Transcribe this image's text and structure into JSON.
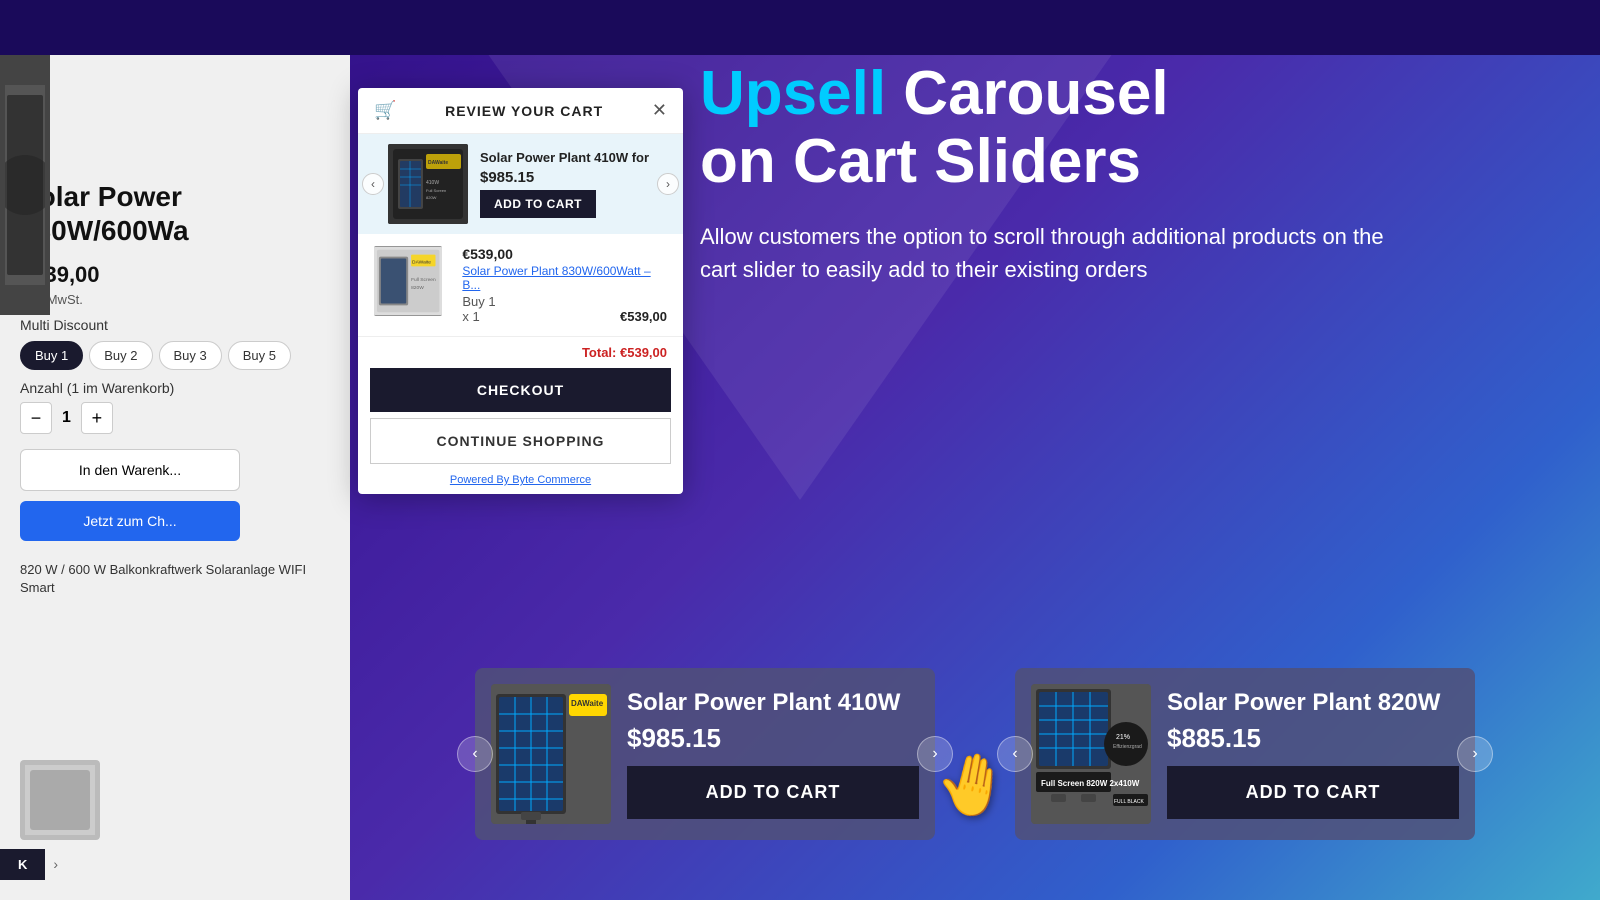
{
  "page": {
    "title": "Upsell Carousel on Cart Sliders"
  },
  "headline": {
    "upsell": "Upsell",
    "rest": " Carousel\non Cart Sliders"
  },
  "subtext": "Allow customers the option to scroll through additional products on the cart slider to easily add to their existing orders",
  "cart_modal": {
    "title": "REVIEW YOUR CART",
    "upsell_product": {
      "name": "Solar Power Plant 410W for",
      "price": "$985.15",
      "add_btn": "ADD TO CART"
    },
    "cart_item": {
      "price": "€539,00",
      "name": "Solar Power Plant 830W/600Watt – B...",
      "buy": "Buy 1",
      "qty": "x 1",
      "subtotal": "€539,00"
    },
    "total_label": "Total:",
    "total_value": "€539,00",
    "checkout_btn": "CHECKOUT",
    "continue_btn": "CONTINUE SHOPPING",
    "powered_by": "Powered By Byte Commerce"
  },
  "left_product": {
    "title": "Solar Power\n830W/600Wa",
    "price": "€539,00",
    "inkl": "inkl. MwSt.",
    "multi_discount_label": "Multi Discount",
    "discount_options": [
      "Buy 1",
      "Buy 2",
      "Buy 3",
      "Buy 5"
    ],
    "active_discount": "Buy 1",
    "anzahl_label": "Anzahl (1 im Warenkorb)",
    "qty": "1",
    "cart_btn": "In den Warenk...",
    "checkout_btn": "Jetzt zum Ch...",
    "desc": "820 W / 600 W Balkonkraftwerk\nSolaranlage WIFI Smart"
  },
  "carousel_1": {
    "name": "Solar Power Plant 410W",
    "price": "$985.15",
    "add_btn": "ADD TO CART"
  },
  "carousel_2": {
    "name": "Solar Power Plant 820W",
    "price": "$885.15",
    "add_btn": "ADD TO CART"
  }
}
